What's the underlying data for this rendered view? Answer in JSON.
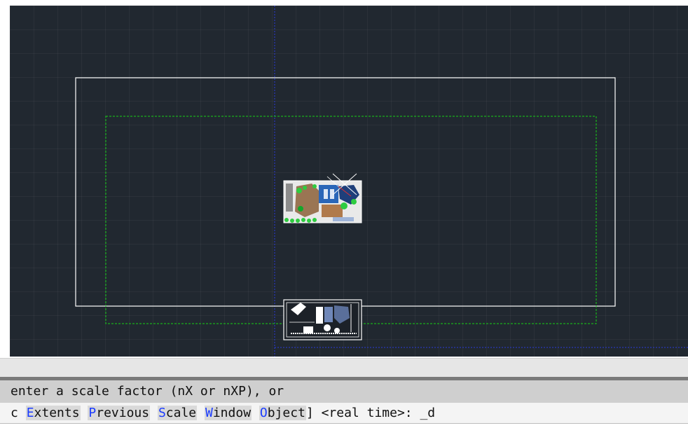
{
  "colors": {
    "canvas_background": "#212830",
    "grid_line": "#2f3741",
    "layout_paper_border": "#ffffff",
    "printable_area_border": "#16d116",
    "ucs_axis": "#2a3ad8",
    "option_key": "#1b3cff"
  },
  "command_history": {
    "text": "enter a scale factor (nX or nXP), or"
  },
  "command_line": {
    "prefix": "c",
    "options": [
      {
        "key": "E",
        "rest": "xtents"
      },
      {
        "key": "P",
        "rest": "revious"
      },
      {
        "key": "S",
        "rest": "cale"
      },
      {
        "key": "W",
        "rest": "indow"
      },
      {
        "key": "O",
        "rest": "bject"
      }
    ],
    "suffix": "] <real time>: ",
    "input_value": "_d"
  },
  "icons": {
    "plan_thumbnail_upper": "floor-plan-drawing-icon",
    "plan_thumbnail_lower": "floor-plan-drawing-icon"
  }
}
